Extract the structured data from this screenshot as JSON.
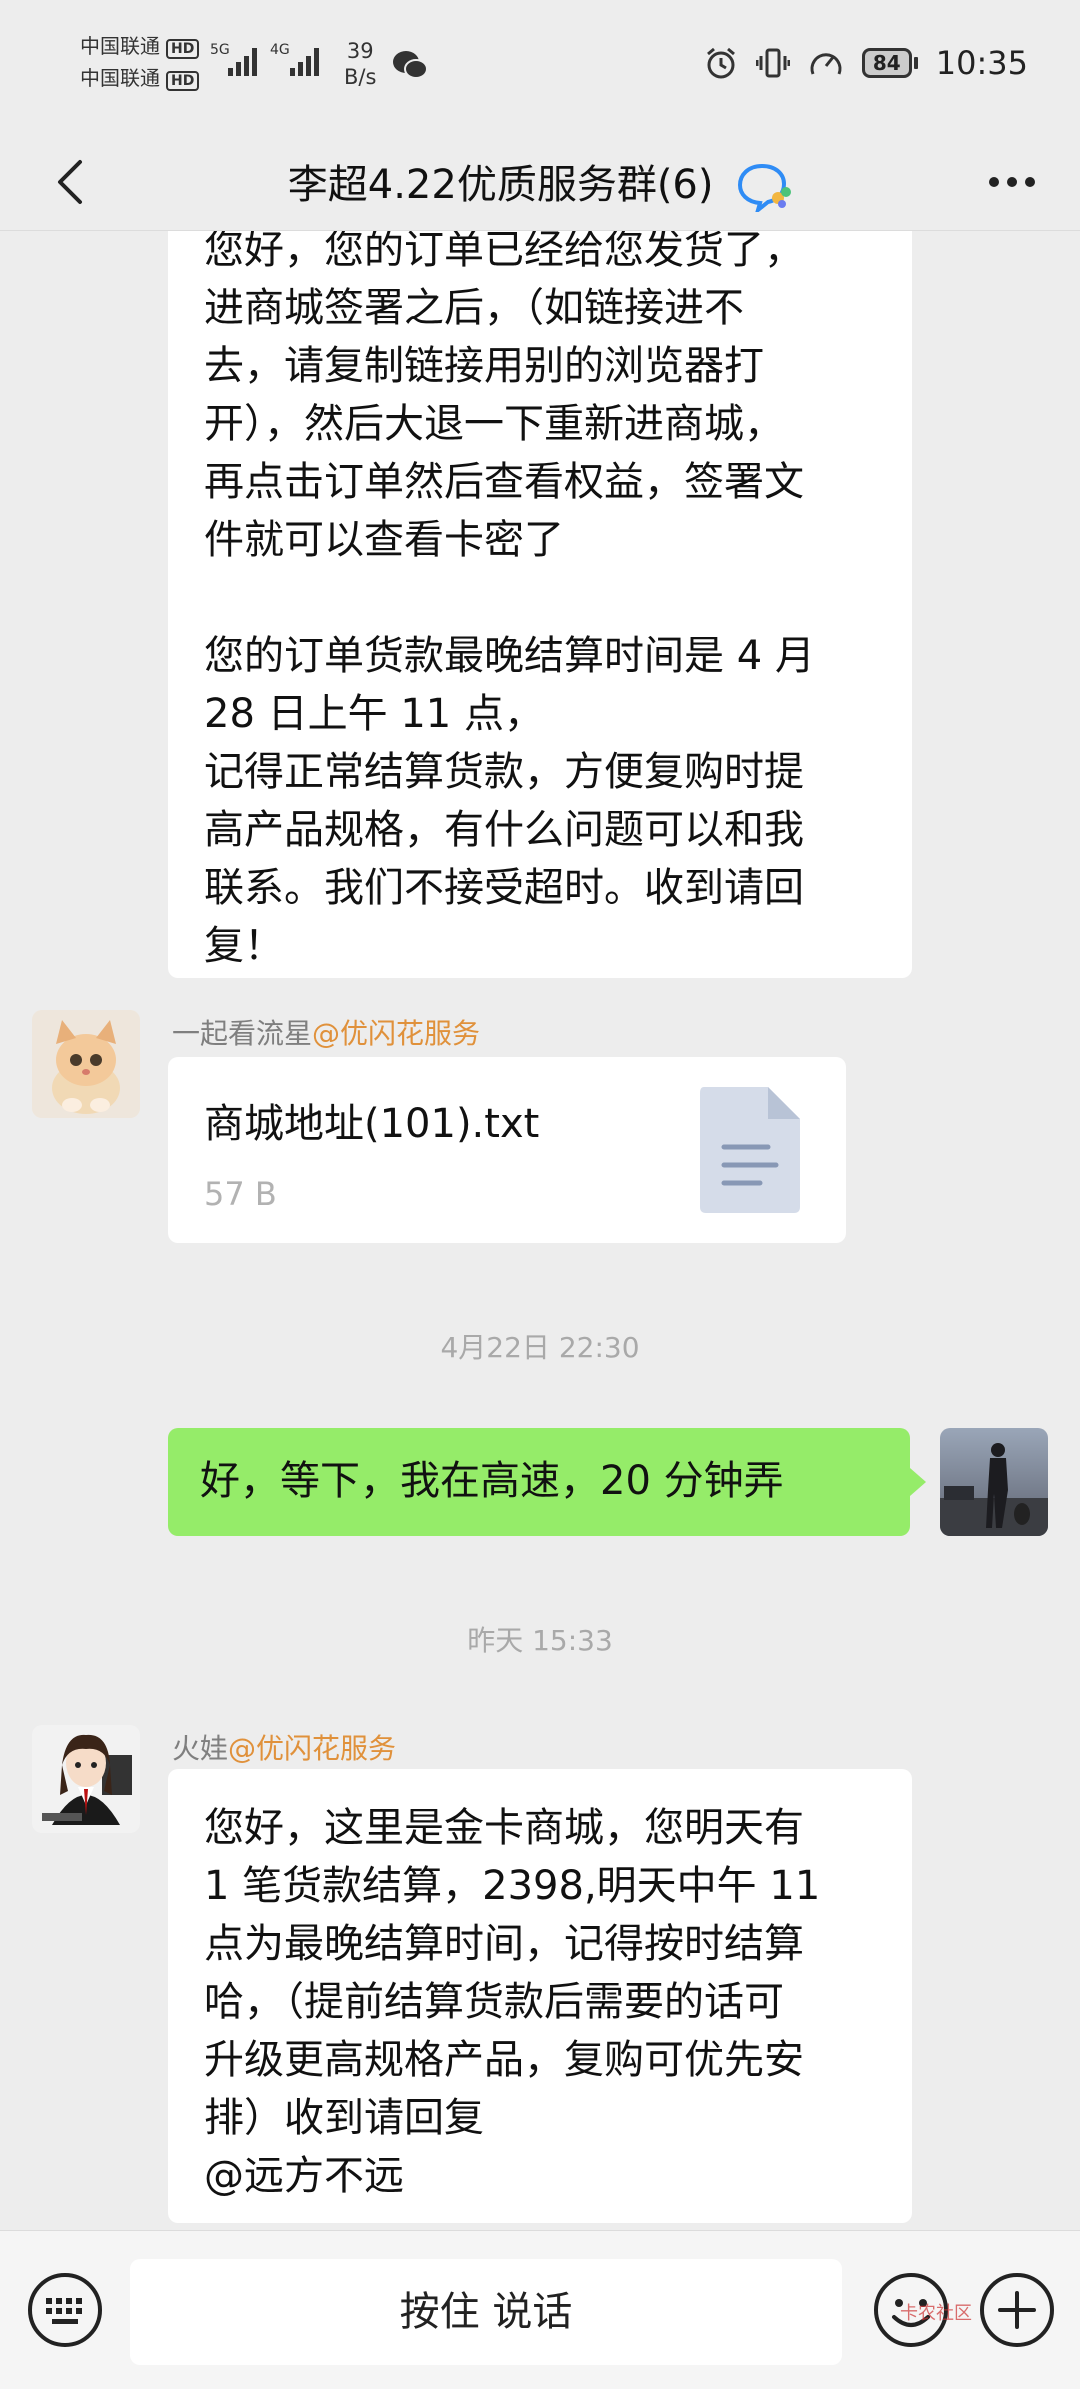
{
  "status": {
    "carrier1": "中国联通",
    "carrier2": "中国联通",
    "hd": "HD",
    "net1": "5G",
    "net2": "4G",
    "speed_value": "39",
    "speed_unit": "B/s",
    "battery": "84",
    "time": "10:35"
  },
  "header": {
    "title": "李超4.22优质服务群(6)"
  },
  "messages": {
    "m1": "您好，您的订单已经给您发货了，\n进商城签署之后，（如链接进不\n去，请复制链接用别的浏览器打\n开），然后大退一下重新进商城，\n再点击订单然后查看权益，签署文\n件就可以查看卡密了\n\n您的订单货款最晚结算时间是 4 月\n28 日上午 11 点，\n记得正常结算货款，方便复购时提\n高产品规格，有什么问题可以和我\n联系。我们不接受超时。收到请回\n复！",
    "sender2_name": "一起看流星",
    "sender2_at": "@优闪花服务",
    "file_name": "商城地址(101).txt",
    "file_size": "57 B",
    "time1": "4月22日 22:30",
    "m3": "好，等下，我在高速，20 分钟弄",
    "time2": "昨天 15:33",
    "sender4_name": "火娃",
    "sender4_at": "@优闪花服务",
    "m4": "您好，这里是金卡商城，您明天有\n1 笔货款结算，2398,明天中午 11\n点为最晚结算时间，记得按时结算\n哈，（提前结算货款后需要的话可\n升级更高规格产品，复购可优先安\n排）收到请回复\n@远方不远"
  },
  "input": {
    "hold_to_talk": "按住 说话"
  },
  "watermark": "卡农社区",
  "colors": {
    "green_bubble": "#95ec69",
    "mention": "#e0913b",
    "background": "#ededed"
  }
}
